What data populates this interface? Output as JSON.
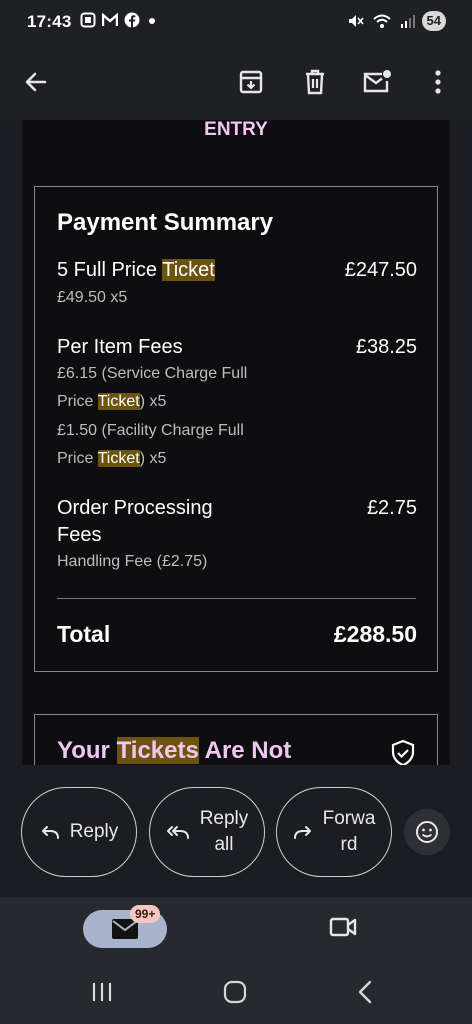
{
  "status_bar": {
    "time": "17:43",
    "left_icons": [
      "screenshot-icon",
      "gmail-icon",
      "facebook-icon",
      "dot-icon"
    ],
    "right_icons": [
      "mute-icon",
      "wifi-icon",
      "signal-icon"
    ],
    "battery": "54"
  },
  "app_bar": {
    "icons": [
      "back-arrow-icon",
      "archive-icon",
      "delete-icon",
      "mark-unread-icon",
      "more-vert-icon"
    ]
  },
  "email": {
    "entry_text": "ENTRY",
    "summary": {
      "title": "Payment Summary",
      "items": [
        {
          "name_prefix": "5 Full Price ",
          "name_highlight": "Ticket",
          "amount": "£247.50",
          "details": [
            {
              "text": "£49.50 x5"
            }
          ]
        },
        {
          "name": "Per Item Fees",
          "amount": "£38.25",
          "details": [
            {
              "text": "£6.15 (Service Charge Full"
            },
            {
              "prefix": "Price ",
              "highlight": "Ticket",
              "suffix": ") x5"
            },
            {
              "text": "£1.50 (Facility Charge Full"
            },
            {
              "prefix": "Price ",
              "highlight": "Ticket",
              "suffix": ") x5"
            }
          ]
        },
        {
          "name_line1": "Order Processing",
          "name_line2": "Fees",
          "amount": "£2.75",
          "details": [
            {
              "text": "Handling Fee (£2.75)"
            }
          ]
        }
      ],
      "total_label": "Total",
      "total_amount": "£288.50"
    },
    "tickets_heading": {
      "prefix": "Your ",
      "highlight": "Tickets",
      "suffix": " Are Not"
    }
  },
  "reply_actions": {
    "reply": "Reply",
    "reply_all_line1": "Reply",
    "reply_all_line2": "all",
    "forward_line1": "Forwa",
    "forward_line2": "rd"
  },
  "bottom_nav": {
    "mail_badge": "99+"
  },
  "colors": {
    "accent_pink": "#f1c7f1",
    "highlight": "#6b5410",
    "background": "#0e0e10",
    "chrome": "#1e2024"
  }
}
